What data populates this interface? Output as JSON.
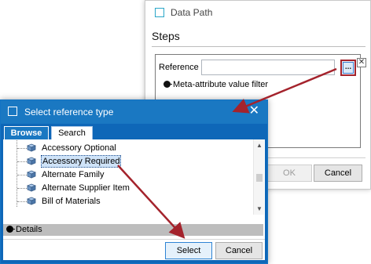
{
  "data_path_dialog": {
    "title": "Data Path",
    "steps_heading": "Steps",
    "reference_label": "Reference",
    "reference_value": "",
    "browse_button_label": "...",
    "meta_filter_label": "Meta-attribute value filter",
    "ok_label": "OK",
    "cancel_label": "Cancel"
  },
  "select_reference_dialog": {
    "title": "Select reference type",
    "close_glyph": "✕",
    "tabs": [
      {
        "label": "Browse",
        "active": true
      },
      {
        "label": "Search",
        "active": false
      }
    ],
    "items": [
      {
        "label": "Accessory Optional",
        "selected": false
      },
      {
        "label": "Accessory Required",
        "selected": true
      },
      {
        "label": "Alternate Family",
        "selected": false
      },
      {
        "label": "Alternate Supplier Item",
        "selected": false
      },
      {
        "label": "Bill of Materials",
        "selected": false
      }
    ],
    "details_label": "Details",
    "select_label": "Select",
    "cancel_label": "Cancel"
  },
  "colors": {
    "titlebar_blue": "#1a78c2",
    "annotation_red": "#a4232c",
    "selection_bg": "#cfe3f8"
  }
}
